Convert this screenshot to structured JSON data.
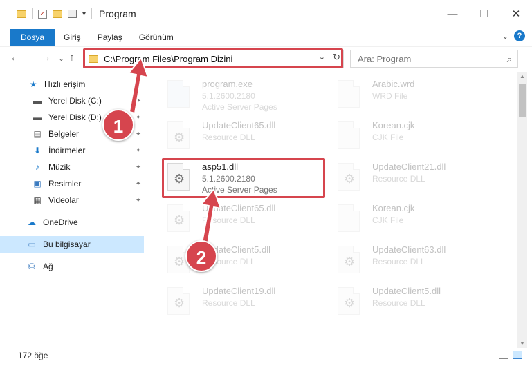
{
  "titlebar": {
    "title": "Program",
    "qat_icons": [
      "folder-icon",
      "checklist-icon",
      "properties-icon",
      "dropdown-arrow-icon"
    ]
  },
  "window_controls": {
    "minimize": "—",
    "maximize": "☐",
    "close": "✕"
  },
  "ribbon": {
    "tabs": [
      {
        "label": "Dosya",
        "active": true
      },
      {
        "label": "Giriş"
      },
      {
        "label": "Paylaş"
      },
      {
        "label": "Görünüm"
      }
    ],
    "expand_icon": "⌄",
    "help_icon": "?"
  },
  "nav": {
    "back": "←",
    "forward": "→",
    "recent": "⌄",
    "up": "↑",
    "address": "C:\\Program Files\\Program Dizini",
    "refresh": "↻",
    "search_placeholder": "Ara: Program",
    "search_icon": "⌕"
  },
  "sidebar": {
    "items": [
      {
        "label": "Hızlı erişim",
        "icon": "★",
        "icon_name": "star-icon",
        "color": "#1979ca"
      },
      {
        "label": "Yerel Disk (C:)",
        "icon": "▬",
        "icon_name": "drive-icon",
        "color": "#555",
        "pinned": true
      },
      {
        "label": "Yerel Disk (D:)",
        "icon": "▬",
        "icon_name": "drive-icon",
        "color": "#555",
        "pinned": true
      },
      {
        "label": "Belgeler",
        "icon": "▤",
        "icon_name": "documents-icon",
        "color": "#666",
        "pinned": true
      },
      {
        "label": "İndirmeler",
        "icon": "⬇",
        "icon_name": "downloads-icon",
        "color": "#1979ca",
        "pinned": true
      },
      {
        "label": "Müzik",
        "icon": "♪",
        "icon_name": "music-icon",
        "color": "#1979ca",
        "pinned": true
      },
      {
        "label": "Resimler",
        "icon": "▣",
        "icon_name": "pictures-icon",
        "color": "#3a7abf",
        "pinned": true
      },
      {
        "label": "Videolar",
        "icon": "▦",
        "icon_name": "videos-icon",
        "color": "#444",
        "pinned": true
      },
      {
        "label": "OneDrive",
        "icon": "☁",
        "icon_name": "onedrive-icon",
        "color": "#1979ca"
      },
      {
        "label": "Bu bilgisayar",
        "icon": "▭",
        "icon_name": "computer-icon",
        "color": "#3a7abf",
        "selected": true
      },
      {
        "label": "Ağ",
        "icon": "⛁",
        "icon_name": "network-icon",
        "color": "#3a7abf"
      }
    ],
    "pin_icon": "📌"
  },
  "files": {
    "left": [
      {
        "name": "program.exe",
        "line2": "5.1.2600.2180",
        "line3": "Active Server Pages"
      },
      {
        "name": "UpdateClient65.dll",
        "line2": "Resource DLL",
        "line3": ""
      },
      {
        "name": "asp51.dll",
        "line2": "5.1.2600.2180",
        "line3": "Active Server Pages",
        "highlight": true
      },
      {
        "name": "UpdateClient65.dll",
        "line2": "Resource DLL",
        "line3": ""
      },
      {
        "name": "UpdateClient5.dll",
        "line2": "Resource DLL",
        "line3": ""
      },
      {
        "name": "UpdateClient19.dll",
        "line2": "Resource DLL",
        "line3": ""
      }
    ],
    "right": [
      {
        "name": "Arabic.wrd",
        "line2": "WRD File",
        "line3": ""
      },
      {
        "name": "Korean.cjk",
        "line2": "CJK File",
        "line3": ""
      },
      {
        "name": "UpdateClient21.dll",
        "line2": "Resource DLL",
        "line3": ""
      },
      {
        "name": "Korean.cjk",
        "line2": "CJK File",
        "line3": ""
      },
      {
        "name": "UpdateClient63.dll",
        "line2": "Resource DLL",
        "line3": ""
      },
      {
        "name": "UpdateClient5.dll",
        "line2": "Resource DLL",
        "line3": ""
      }
    ]
  },
  "status": {
    "count": "172 öğe"
  },
  "annotations": {
    "badge1": "1",
    "badge2": "2",
    "color": "#d6454e"
  }
}
